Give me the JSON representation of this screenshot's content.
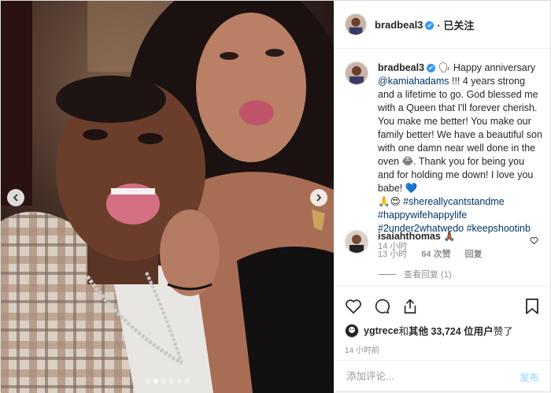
{
  "header": {
    "username": "bradbeal3",
    "verified_mark": "✔",
    "follow_status": "· 已关注"
  },
  "caption": {
    "username": "bradbeal3",
    "emoji_speaking": "🗣",
    "text_1": " Happy anniversary ",
    "mention": "@kamiahadams",
    "text_2": " !!! 4 years strong and a lifetime to go. God blessed me with a Queen that I'll forever cherish. You make me better! You make our family better! We have a beautiful son with one damn near well done in the oven ",
    "emoji_laugh": "😂",
    "text_3": ". Thank you for being you and for holding me down! I love you babe! ",
    "emoji_heart": "💙",
    "emoji_pray": "🙏",
    "emoji_hearteyes": "😍",
    "hashtags": "#shereallycantstandme #happywifehappylife #2under2whatwedo #keepshootinb",
    "time": "14 小时"
  },
  "comment": {
    "username": "isaiahthomas",
    "text": "🙏🏾",
    "time": "13 小时",
    "likes": "64 次赞",
    "reply": "回复",
    "view_replies": "查看回复 (1)"
  },
  "actions": {
    "liked_by": "ygtrece",
    "likes_text_1": " 和 ",
    "others_label": "其他 33,724 位用户",
    "likes_text_2": " 赞了",
    "timestamp": "14 小时前"
  },
  "comment_box": {
    "placeholder": "添加评论...",
    "post_label": "发布"
  },
  "carousel": {
    "total": 6,
    "active": 2
  },
  "colors": {
    "link": "#003569",
    "verified": "#3897f0",
    "muted": "#8e8e8e",
    "post_disabled": "#b2dffc"
  },
  "icons": [
    "heart-icon",
    "comment-icon",
    "share-icon",
    "bookmark-icon",
    "chevron-left-icon",
    "chevron-right-icon"
  ]
}
